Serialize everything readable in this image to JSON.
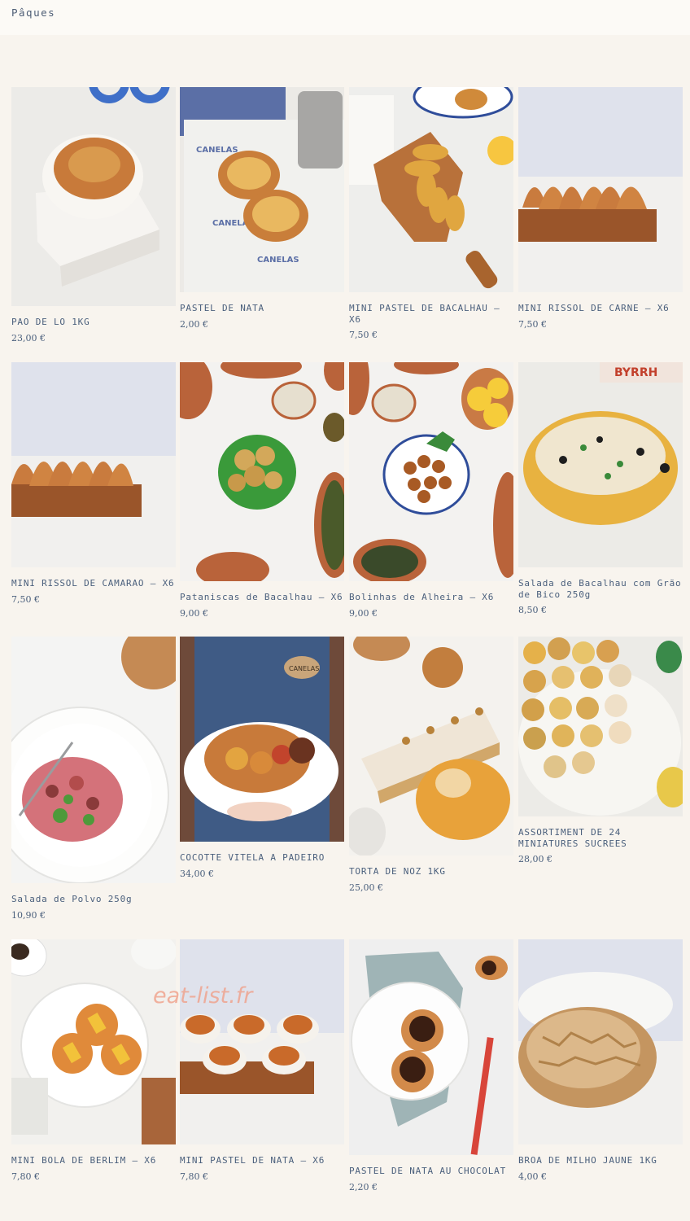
{
  "header": {
    "title": "Pâques"
  },
  "watermark": "eat-list.fr",
  "products": [
    {
      "name": "PAO DE LO 1KG",
      "price": "23,00 €"
    },
    {
      "name": "PASTEL DE NATA",
      "price": "2,00 €"
    },
    {
      "name": "MINI PASTEL DE BACALHAU – X6",
      "price": "7,50 €"
    },
    {
      "name": "MINI RISSOL DE CARNE – X6",
      "price": "7,50 €"
    },
    {
      "name": "MINI RISSOL DE CAMARAO – X6",
      "price": "7,50 €"
    },
    {
      "name": "Pataniscas de Bacalhau – X6",
      "price": "9,00 €"
    },
    {
      "name": "Bolinhas de Alheira – X6",
      "price": "9,00 €"
    },
    {
      "name": "Salada de Bacalhau com Grão de Bico 250g",
      "price": "8,50 €"
    },
    {
      "name": "Salada de Polvo 250g",
      "price": "10,90 €"
    },
    {
      "name": "COCOTTE VITELA A PADEIRO",
      "price": "34,00 €"
    },
    {
      "name": "TORTA DE NOZ 1KG",
      "price": "25,00 €"
    },
    {
      "name": "ASSORTIMENT DE 24 MINIATURES SUCREES",
      "price": "28,00 €"
    },
    {
      "name": "MINI BOLA DE BERLIM – X6",
      "price": "7,80 €"
    },
    {
      "name": "MINI PASTEL DE NATA – X6",
      "price": "7,80 €"
    },
    {
      "name": "PASTEL DE NATA AU CHOCOLAT",
      "price": "2,20 €"
    },
    {
      "name": "BROA DE MILHO JAUNE 1KG",
      "price": "4,00 €"
    }
  ]
}
